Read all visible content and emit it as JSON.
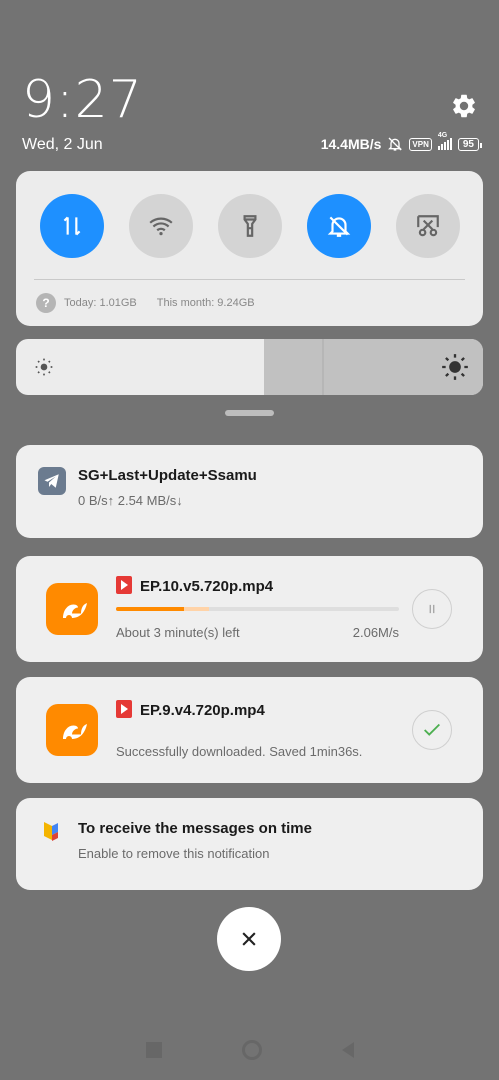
{
  "status": {
    "time": "9:27",
    "date": "Wed, 2 Jun",
    "network_speed": "14.4MB/s",
    "vpn_label": "VPN",
    "signal_label": "4G",
    "battery": "95"
  },
  "quick_settings": {
    "tiles": [
      {
        "icon": "mobile-data-icon",
        "active": true
      },
      {
        "icon": "wifi-icon",
        "active": false
      },
      {
        "icon": "flashlight-icon",
        "active": false
      },
      {
        "icon": "mute-bell-icon",
        "active": true
      },
      {
        "icon": "screenshot-icon",
        "active": false
      }
    ],
    "data_today": "Today: 1.01GB",
    "data_month": "This month: 9.24GB",
    "help_glyph": "?"
  },
  "brightness": {
    "level": 0.53
  },
  "notifications": {
    "telegram": {
      "title": "SG+Last+Update+Ssamu",
      "subtitle": "0 B/s↑ 2.54 MB/s↓"
    },
    "download_active": {
      "filename": "EP.10.v5.720p.mp4",
      "time_left": "About 3 minute(s) left",
      "speed": "2.06M/s",
      "progress": 0.24,
      "buffered": 0.33
    },
    "download_done": {
      "filename": "EP.9.v4.720p.mp4",
      "status": "Successfully downloaded. Saved 1min36s."
    },
    "promo": {
      "title": "To receive the messages on time",
      "subtitle": "Enable to remove this notification"
    }
  },
  "colors": {
    "accent": "#1e90ff",
    "uc_orange": "#ff8a00",
    "check_green": "#4caf50"
  }
}
